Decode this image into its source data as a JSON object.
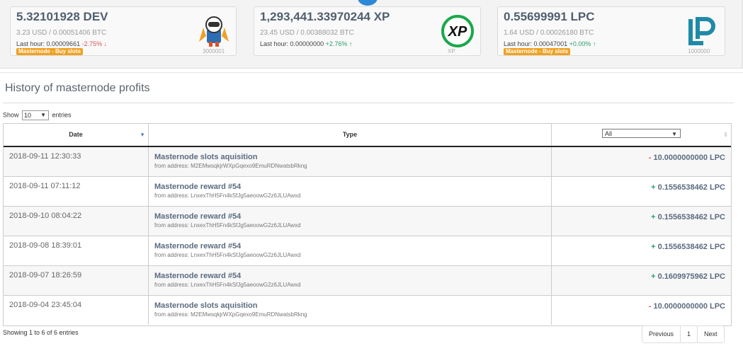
{
  "cards": [
    {
      "amount": "5.32101928 DEV",
      "usd": "3.23 USD / 0.00051406 BTC",
      "last_hour_label": "Last hour: 0.00009661",
      "change": "-2.75%",
      "change_dir": "down",
      "badge": "Masternode - Buy slots",
      "logo_caption": "3000001",
      "icon": "astronaut-rocket-icon"
    },
    {
      "amount": "1,293,441.33970244 XP",
      "usd": "23.45 USD / 0.00388032 BTC",
      "last_hour_label": "Last hour: 0.00000000",
      "change": "+2.76%",
      "change_dir": "up",
      "badge": "",
      "logo_caption": "XP",
      "icon": "xp-logo-icon"
    },
    {
      "amount": "0.55699991 LPC",
      "usd": "1.64 USD / 0.00026180 BTC",
      "last_hour_label": "Last hour: 0.00047001",
      "change": "+0.00%",
      "change_dir": "up",
      "badge": "Masternode - Buy slots",
      "logo_caption": "1000000",
      "icon": "lp-logo-icon"
    }
  ],
  "section_title": "History of masternode profits",
  "length": {
    "prefix": "Show",
    "value": "10",
    "suffix": "entries"
  },
  "table": {
    "headers": {
      "date": "Date",
      "type": "Type",
      "filter": "All"
    },
    "rows": [
      {
        "date": "2018-09-11 12:30:33",
        "title": "Masternode slots aquisition",
        "from": "from address: M2EMwsqkjrWXpGqexo9EmuRDNwatsbRkng",
        "sign": "-",
        "amount": "10.0000000000 LPC"
      },
      {
        "date": "2018-09-11 07:11:12",
        "title": "Masternode reward #54",
        "from": "from address: LnxexThH5Fn4kSfJg5aeoowG2z6JLUAwxd",
        "sign": "+",
        "amount": "0.1556538462 LPC"
      },
      {
        "date": "2018-09-10 08:04:22",
        "title": "Masternode reward #54",
        "from": "from address: LnxexThH5Fn4kSfJg5aeoowG2z6JLUAwxd",
        "sign": "+",
        "amount": "0.1556538462 LPC"
      },
      {
        "date": "2018-09-08 18:39:01",
        "title": "Masternode reward #54",
        "from": "from address: LnxexThH5Fn4kSfJg5aeoowG2z6JLUAwxd",
        "sign": "+",
        "amount": "0.1556538462 LPC"
      },
      {
        "date": "2018-09-07 18:26:59",
        "title": "Masternode reward #54",
        "from": "from address: LnxexThH5Fn4kSfJg5aeoowG2z6JLUAwxd",
        "sign": "+",
        "amount": "0.1609975962 LPC"
      },
      {
        "date": "2018-09-04 23:45:04",
        "title": "Masternode slots aquisition",
        "from": "from address: M2EMwsqkjrWXpGqexo9EmuRDNwatsbRkng",
        "sign": "-",
        "amount": "10.0000000000 LPC"
      }
    ]
  },
  "info": "Showing 1 to 6 of 6 entries",
  "pager": {
    "previous": "Previous",
    "page": "1",
    "next": "Next"
  },
  "colors": {
    "accent": "#2d88d6",
    "badge": "#f0a020",
    "positive": "#2a9d6e",
    "negative": "#d9534f",
    "xp_green": "#1aa84a",
    "lp_teal": "#1f8aa8"
  }
}
